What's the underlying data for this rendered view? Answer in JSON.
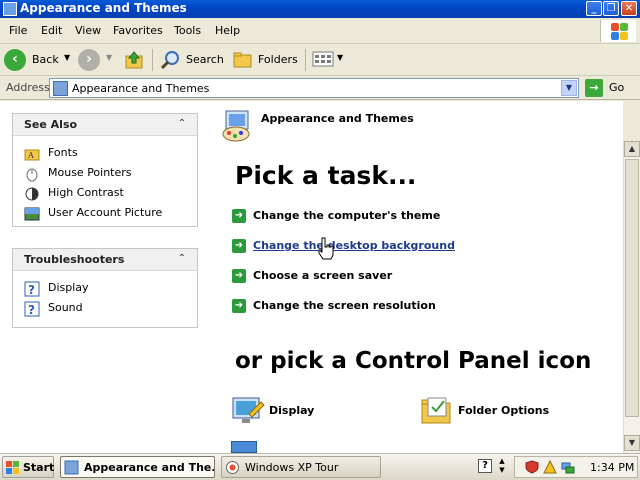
{
  "window": {
    "title": "Appearance and Themes",
    "min": "_",
    "restore": "❐",
    "close": "✕"
  },
  "menu": [
    "File",
    "Edit",
    "View",
    "Favorites",
    "Tools",
    "Help"
  ],
  "toolbar": {
    "back": "Back",
    "search": "Search",
    "folders": "Folders"
  },
  "address": {
    "label": "Address",
    "value": "Appearance and Themes",
    "go": "Go"
  },
  "see_also": {
    "title": "See Also",
    "items": [
      "Fonts",
      "Mouse Pointers",
      "High Contrast",
      "User Account Picture"
    ]
  },
  "troubleshooters": {
    "title": "Troubleshooters",
    "items": [
      "Display",
      "Sound"
    ]
  },
  "main": {
    "header": "Appearance and Themes",
    "pick_task": "Pick a task...",
    "tasks": [
      "Change the computer's theme",
      "Change the desktop background",
      "Choose a screen saver",
      "Change the screen resolution"
    ],
    "pick_icon": "or pick a Control Panel icon",
    "icons": [
      "Display",
      "Folder Options"
    ]
  },
  "taskbar": {
    "start": "Start",
    "buttons": [
      "Appearance and The...",
      "Windows XP Tour"
    ],
    "time": "1:34 PM"
  },
  "colors": {
    "titlebar": "#0a5bd6",
    "taskarrow": "#2a9a3c",
    "link": "#1e3a8a"
  }
}
